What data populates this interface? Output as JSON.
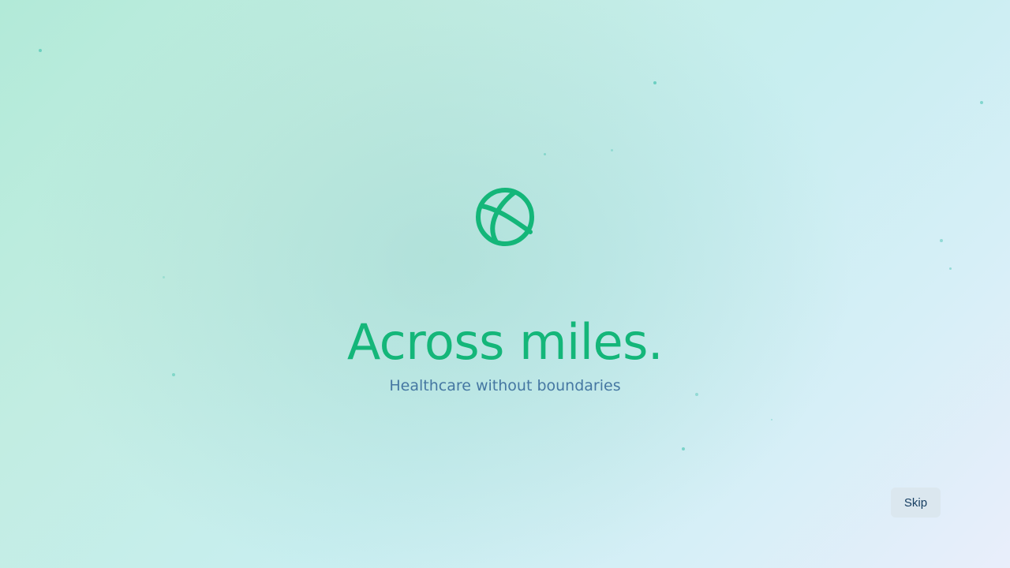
{
  "splash": {
    "headline": "Across miles.",
    "subtitle": "Healthcare without boundaries",
    "logo_icon": "globe-icon",
    "accent_color": "#14b679",
    "subtitle_color": "#4577a2"
  },
  "actions": {
    "skip_label": "Skip"
  }
}
